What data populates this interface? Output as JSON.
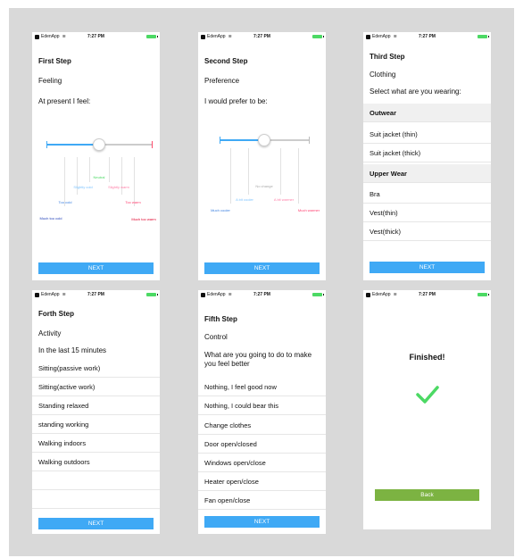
{
  "status": {
    "carrier": "EdenApp",
    "time": "7:27 PM"
  },
  "colors": {
    "accent": "#3fa9f5",
    "back_button": "#7cb342",
    "check": "#4cd964"
  },
  "screen1": {
    "title": "First Step",
    "label": "Feeling",
    "prompt": "At present I feel:",
    "scale": {
      "neutral": "Neutral",
      "slightly_cold": "Slightly cold",
      "slightly_warm": "Slightly warm",
      "too_cold": "Too cold",
      "too_warm": "Too warm",
      "much_too_cold": "Much too cold",
      "much_too_warm": "Much too warm"
    },
    "slider_value": 0.5,
    "button": "NEXT"
  },
  "screen2": {
    "title": "Second Step",
    "label": "Preference",
    "prompt": "I would prefer to be:",
    "scale": {
      "no_change": "No change",
      "a_bit_cooler": "A bit cooler",
      "a_bit_warmer": "A bit warmer",
      "much_cooler": "Much cooler",
      "much_warmer": "Much warmer"
    },
    "slider_value": 0.5,
    "button": "NEXT"
  },
  "screen3": {
    "title": "Third Step",
    "label": "Clothing",
    "prompt": "Select what are you wearing:",
    "sections": [
      {
        "header": "Outwear",
        "items": [
          "Suit jacket (thin)",
          "Suit jacket (thick)"
        ]
      },
      {
        "header": "Upper Wear",
        "items": [
          "Bra",
          "Vest(thin)",
          "Vest(thick)"
        ]
      }
    ],
    "button": "NEXT"
  },
  "screen4": {
    "title": "Forth Step",
    "label": "Activity",
    "prompt": "In the last 15 minutes",
    "items": [
      "Sitting(passive work)",
      "Sitting(active work)",
      "Standing relaxed",
      "standing working",
      "Walking indoors",
      "Walking outdoors"
    ],
    "button": "NEXT"
  },
  "screen5": {
    "title": "Fifth Step",
    "label": "Control",
    "prompt_line1": "What are you going to do to make",
    "prompt_line2": "you feel better",
    "items": [
      "Nothing, I feel good now",
      "Nothing, I could bear this",
      "Change clothes",
      "Door open/closed",
      "Windows open/close",
      "Heater open/close",
      "Fan open/close"
    ],
    "button": "NEXT"
  },
  "screen6": {
    "title": "Finished!",
    "button": "Back"
  }
}
